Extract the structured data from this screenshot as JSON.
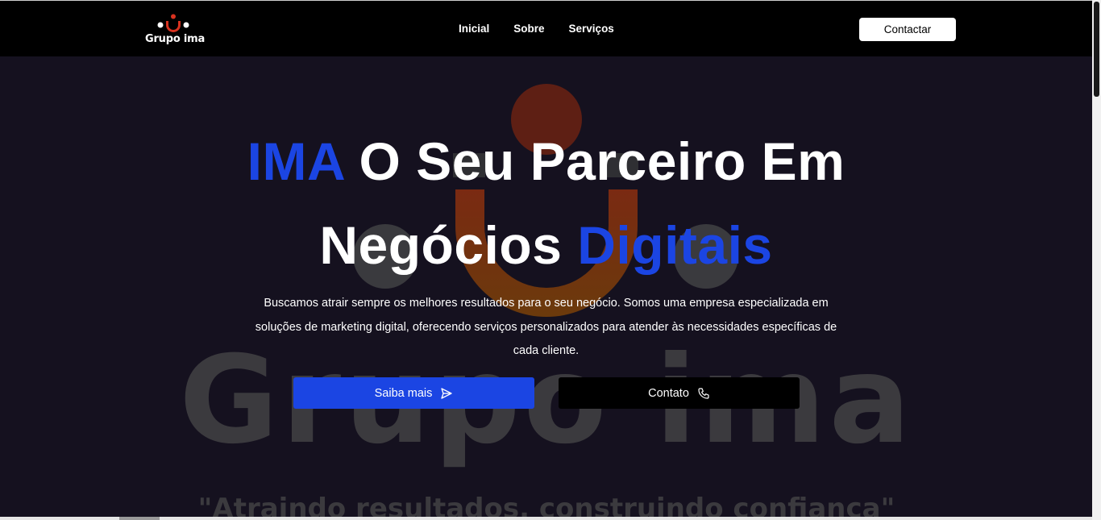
{
  "navbar": {
    "logo_text": "Grupo ima",
    "links": [
      "Inicial",
      "Sobre",
      "Serviços"
    ],
    "cta_label": "Contactar"
  },
  "hero": {
    "title_accent_1": "IMA",
    "title_main": " O Seu Parceiro Em",
    "title_line2_main": "Negócios ",
    "title_accent_2": "Digitais",
    "description": "Buscamos atrair sempre os melhores resultados para o seu negócio. Somos uma empresa especializada em soluções de marketing digital, oferecendo serviços personalizados para atender às necessidades específicas de cada cliente.",
    "primary_button": "Saiba mais",
    "primary_icon": "send-icon",
    "secondary_button": "Contato",
    "secondary_icon": "phone-icon",
    "bg_watermark_text": "Grupo ima",
    "bg_slogan": "\"Atraindo resultados, construindo confiança\""
  },
  "colors": {
    "accent": "#1b45e3",
    "navbar": "#000000",
    "hero_bg": "#15111f",
    "logo_red": "#d8321f"
  }
}
